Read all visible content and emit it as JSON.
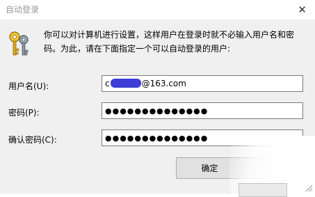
{
  "window": {
    "title": "自动登录",
    "close_glyph": "✕"
  },
  "description": {
    "line1": "你可以对计算机进行设置，这样用户在登录时就不必输入用户名和密",
    "line2": "码。为此，请在下面指定一个可以自动登录的用户:"
  },
  "fields": {
    "username": {
      "label": "用户名(U):",
      "value_prefix": "c",
      "value_suffix": "@163.com"
    },
    "password": {
      "label": "密码(P):",
      "value": "●●●●●●●●●●●●●●"
    },
    "confirm_password": {
      "label": "确认密码(C):",
      "value": "●●●●●●●●●●●●●●"
    }
  },
  "buttons": {
    "ok_label": "确定"
  },
  "icons": {
    "dialog_icon": "keys-icon",
    "close_icon": "close-icon"
  },
  "colors": {
    "window_background": "#f0f0f0",
    "redaction": "#3d3dd8"
  }
}
